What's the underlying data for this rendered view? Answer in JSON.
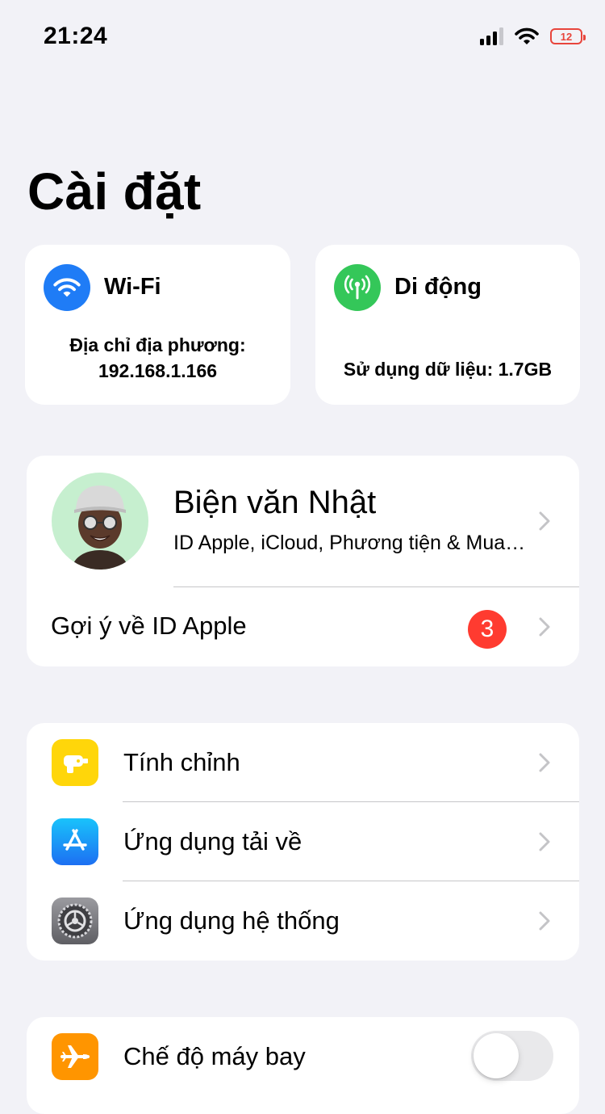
{
  "status_bar": {
    "time": "21:24",
    "battery_level": "12",
    "icons": [
      "cellular-signal-icon",
      "wifi-icon",
      "battery-icon"
    ]
  },
  "page": {
    "title": "Cài đặt"
  },
  "wifi_card": {
    "title": "Wi-Fi",
    "subtitle_line1": "Địa chỉ địa phương:",
    "subtitle_line2": "192.168.1.166",
    "icon": "wifi-icon",
    "color": "#1f7cf6"
  },
  "cellular_card": {
    "title": "Di động",
    "subtitle": "Sử dụng dữ liệu: 1.7GB",
    "icon": "cellular-antenna-icon",
    "color": "#34c759"
  },
  "profile": {
    "name": "Biện văn Nhật",
    "subtitle": "ID Apple, iCloud, Phương tiện & Mua hàng",
    "suggestions_label": "Gợi ý về ID Apple",
    "suggestions_badge": "3"
  },
  "general_group": {
    "items": [
      {
        "label": "Tính chỉnh",
        "icon": "customize-icon",
        "color": "#ffd60a"
      },
      {
        "label": "Ứng dụng tải về",
        "icon": "app-store-icon",
        "color": "#1c8ef9"
      },
      {
        "label": "Ứng dụng hệ thống",
        "icon": "settings-gear-icon",
        "color": "#8e8e93"
      }
    ]
  },
  "network_group": {
    "items": [
      {
        "label": "Chế độ máy bay",
        "icon": "airplane-icon",
        "color": "#ff9500",
        "toggle_on": false
      }
    ]
  },
  "colors": {
    "background": "#f2f2f7",
    "badge": "#ff3b30",
    "battery_low": "#e8453c"
  }
}
